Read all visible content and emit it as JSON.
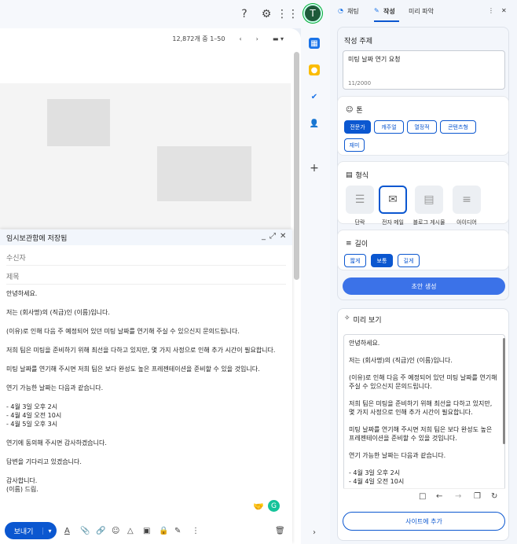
{
  "gmail": {
    "top_icons": [
      "help-icon",
      "settings-icon",
      "apps-grid-icon"
    ],
    "avatar_letter": "T",
    "pager_text": "12,872개 중 1–50",
    "compose": {
      "title": "임시보관함에 저장됨",
      "to_placeholder": "수신자",
      "subject_placeholder": "제목",
      "body": [
        "안녕하세요.",
        "저는 (회사명)의 (직급)인 (이름)입니다.",
        "(이유)로 인해 다음 주 예정되어 있던 미팅 날짜를 연기해 주실 수 있으신지 문의드립니다.",
        "저희 팀은 미팅을 준비하기 위해 최선을 다하고 있지만, 몇 가지 사정으로 인해 추가 시간이 필요합니다.",
        "미팅 날짜를 연기해 주시면 저희 팀은 보다 완성도 높은 프레젠테이션을 준비할 수 있을 것입니다.",
        "연기 가능한 날짜는 다음과 같습니다.",
        "- 4월 3일 오후 2시\n- 4월 4일 오전 10시\n- 4월 5일 오후 3시",
        "연기에 동의해 주시면 감사하겠습니다.",
        "답변을 기다리고 있겠습니다.",
        "감사합니다.\n(이름) 드림."
      ],
      "send_label": "보내기"
    }
  },
  "panel": {
    "tabs": [
      "채팅",
      "작성",
      "미리 파악"
    ],
    "active_tab": "작성",
    "topic_label": "작성 주제",
    "topic_value": "미팅 날짜 연기 요청",
    "topic_count": "11/2000",
    "tone_label": "톤",
    "tones": [
      "전문가",
      "캐주얼",
      "열정적",
      "콘텐츠형",
      "재미"
    ],
    "tone_selected": "전문가",
    "format_label": "형식",
    "formats": [
      "단락",
      "전자 메일",
      "블로그 게시물",
      "아이디어"
    ],
    "format_selected": "전자 메일",
    "length_label": "길이",
    "lengths": [
      "짧게",
      "보통",
      "길게"
    ],
    "length_selected": "보통",
    "generate_label": "초안 생성",
    "preview_label": "미리 보기",
    "preview_text": [
      "안녕하세요.",
      "저는 (회사명)의 (직급)인 (이름)입니다.",
      "(이유)로 인해 다음 주 예정되어 있던 미팅 날짜를 연기해 주실 수 있으신지 문의드립니다.",
      "저희 팀은 미팅을 준비하기 위해 최선을 다하고 있지만, 몇 가지 사정으로 인해 추가 시간이 필요합니다.",
      "미팅 날짜를 연기해 주시면 저희 팀은 보다 완성도 높은 프레젠테이션을 준비할 수 있을 것입니다.",
      "연기 가능한 날짜는 다음과 같습니다.",
      "- 4월 3일 오후 2시\n- 4월 4일 오전 10시"
    ],
    "add_site_label": "사이트에 추가"
  },
  "colors": {
    "accent": "#0b57d0",
    "generate": "#3b72e8"
  }
}
